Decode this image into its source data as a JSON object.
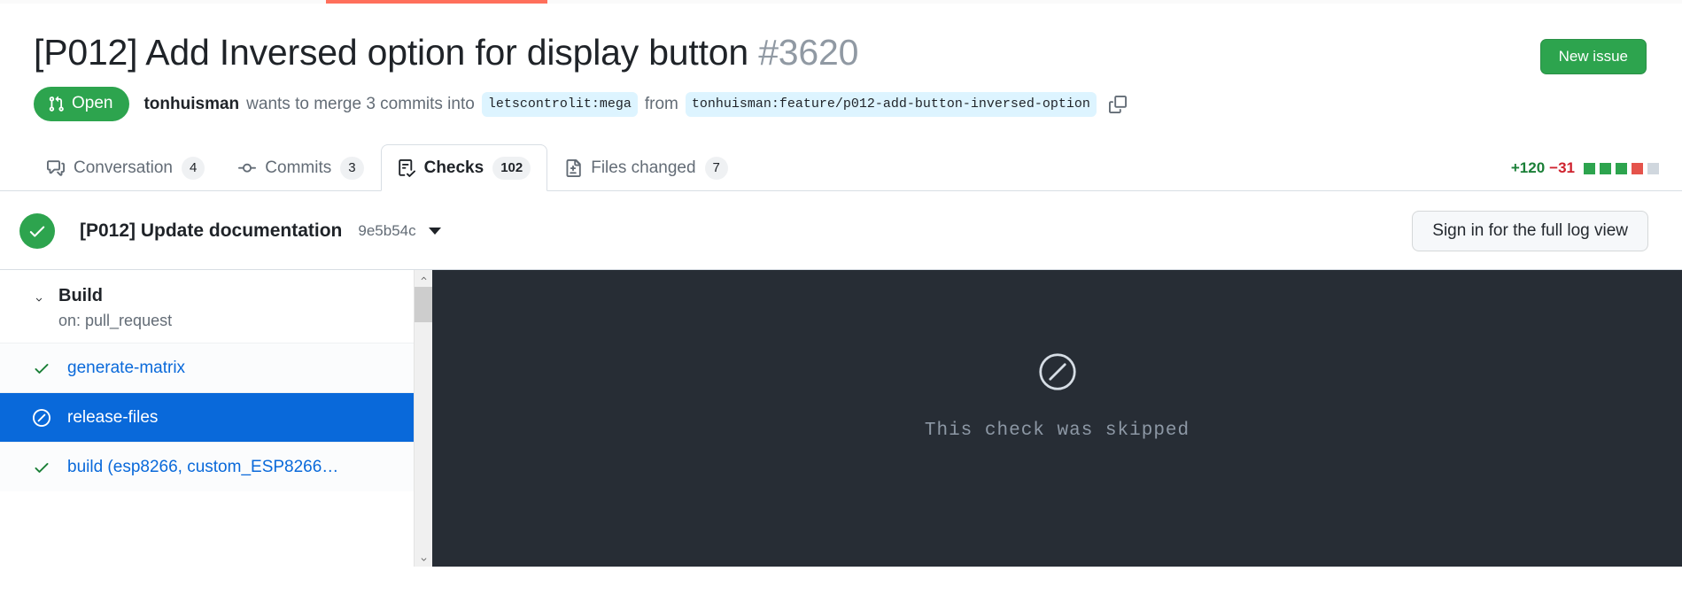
{
  "progress": {
    "percent": 33
  },
  "header": {
    "title": "[P012] Add Inversed option for display button",
    "number": "#3620",
    "new_issue_label": "New issue",
    "state": "Open",
    "author": "tonhuisman",
    "merge_text": "wants to merge 3 commits into",
    "base_branch": "letscontrolit:mega",
    "from_text": "from",
    "head_branch": "tonhuisman:feature/p012-add-button-inversed-option",
    "copy_icon": "clipboard-copy-icon",
    "state_icon": "pull-request-icon",
    "accent_green": "#2da44e"
  },
  "tabs": [
    {
      "label": "Conversation",
      "count": "4",
      "icon": "comment-discussion-icon",
      "active": false
    },
    {
      "label": "Commits",
      "count": "3",
      "icon": "git-commit-icon",
      "active": false
    },
    {
      "label": "Checks",
      "count": "102",
      "icon": "checklist-icon",
      "active": true
    },
    {
      "label": "Files changed",
      "count": "7",
      "icon": "file-diff-icon",
      "active": false
    }
  ],
  "diffstat": {
    "additions": "+120",
    "deletions": "−31",
    "blocks": [
      "g",
      "g",
      "g",
      "r",
      "n"
    ],
    "add_color": "#1a7f37",
    "del_color": "#cf222e"
  },
  "commit": {
    "status_icon": "check-circle-icon",
    "title": "[P012] Update documentation",
    "sha": "9e5b54c",
    "caret_icon": "triangle-down-icon",
    "signin_label": "Sign in for the full log view"
  },
  "workflow": {
    "chevron_icon": "chevron-down-icon",
    "name": "Build",
    "trigger": "on: pull_request"
  },
  "checks": [
    {
      "label": "generate-matrix",
      "icon": "check-icon",
      "status": "success",
      "selected": false
    },
    {
      "label": "release-files",
      "icon": "skip-icon",
      "status": "skipped",
      "selected": true
    },
    {
      "label": "build (esp8266, custom_ESP8266…",
      "icon": "check-icon",
      "status": "success",
      "selected": false
    }
  ],
  "scrollbar": {
    "up_icon": "chevron-up-icon",
    "down_icon": "chevron-down-icon"
  },
  "log": {
    "icon": "skip-circle-icon",
    "message": "This check was skipped",
    "background": "#272d35"
  }
}
